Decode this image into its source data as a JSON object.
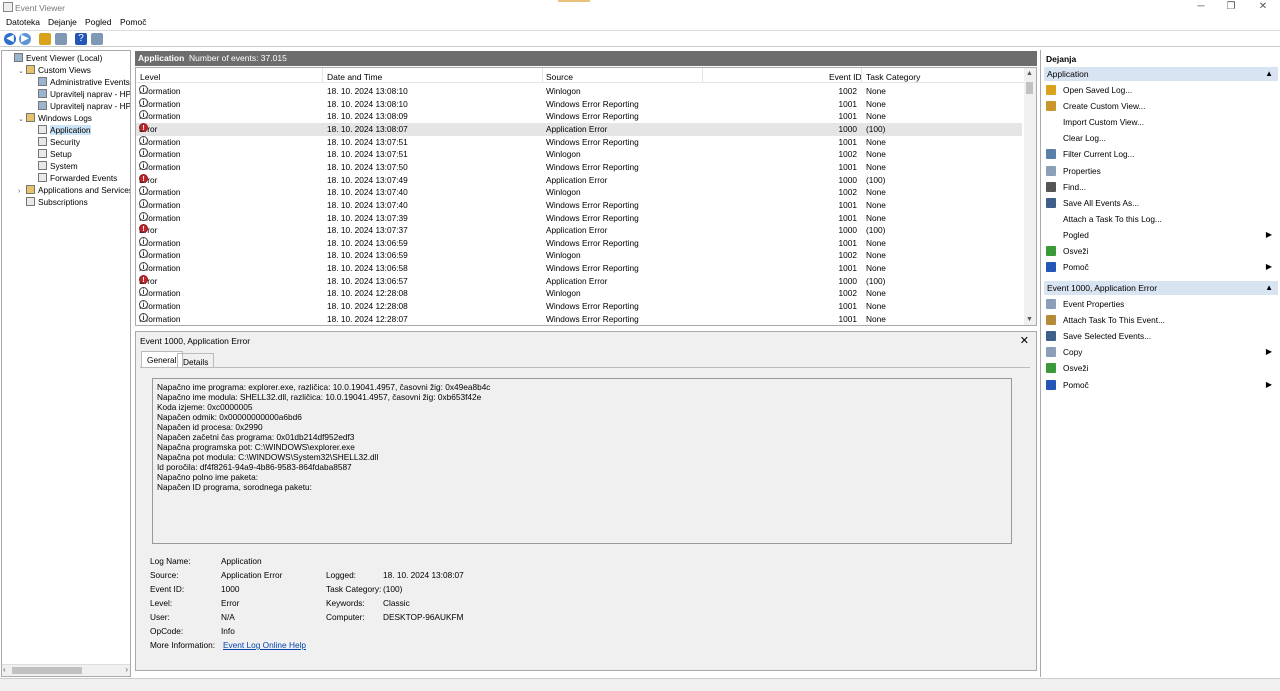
{
  "window": {
    "title": "Event Viewer",
    "controls": [
      "─",
      "❐",
      "✕"
    ]
  },
  "menu": [
    "Datoteka",
    "Dejanje",
    "Pogled",
    "Pomoč"
  ],
  "tree": [
    {
      "label": "Event Viewer (Local)",
      "indent": 0,
      "expander": "",
      "icon": "computer-icon"
    },
    {
      "label": "Custom Views",
      "indent": 1,
      "expander": "v",
      "icon": "folder-icon"
    },
    {
      "label": "Administrative Events",
      "indent": 2,
      "expander": "",
      "icon": "filter-icon"
    },
    {
      "label": "Upravitelj naprav - HP De",
      "indent": 2,
      "expander": "",
      "icon": "filter-icon"
    },
    {
      "label": "Upravitelj naprav - HP De",
      "indent": 2,
      "expander": "",
      "icon": "filter-icon"
    },
    {
      "label": "Windows Logs",
      "indent": 1,
      "expander": "v",
      "icon": "folder-icon"
    },
    {
      "label": "Application",
      "indent": 2,
      "expander": "",
      "icon": "log-icon",
      "selected": true
    },
    {
      "label": "Security",
      "indent": 2,
      "expander": "",
      "icon": "log-icon"
    },
    {
      "label": "Setup",
      "indent": 2,
      "expander": "",
      "icon": "log-icon"
    },
    {
      "label": "System",
      "indent": 2,
      "expander": "",
      "icon": "log-icon"
    },
    {
      "label": "Forwarded Events",
      "indent": 2,
      "expander": "",
      "icon": "log-icon"
    },
    {
      "label": "Applications and Services Lo",
      "indent": 1,
      "expander": ">",
      "icon": "folder-icon"
    },
    {
      "label": "Subscriptions",
      "indent": 1,
      "expander": "",
      "icon": "subscriptions-icon"
    }
  ],
  "center": {
    "log_name": "Application",
    "count_text": "Number of events: 37.015"
  },
  "columns": [
    "Level",
    "Date and Time",
    "Source",
    "Event ID",
    "Task Category"
  ],
  "events": [
    {
      "level": "Information",
      "date": "18. 10. 2024 13:08:10",
      "source": "Winlogon",
      "id": "1002",
      "cat": "None"
    },
    {
      "level": "Information",
      "date": "18. 10. 2024 13:08:10",
      "source": "Windows Error Reporting",
      "id": "1001",
      "cat": "None"
    },
    {
      "level": "Information",
      "date": "18. 10. 2024 13:08:09",
      "source": "Windows Error Reporting",
      "id": "1001",
      "cat": "None"
    },
    {
      "level": "Error",
      "date": "18. 10. 2024 13:08:07",
      "source": "Application Error",
      "id": "1000",
      "cat": "(100)",
      "selected": true
    },
    {
      "level": "Information",
      "date": "18. 10. 2024 13:07:51",
      "source": "Windows Error Reporting",
      "id": "1001",
      "cat": "None"
    },
    {
      "level": "Information",
      "date": "18. 10. 2024 13:07:51",
      "source": "Winlogon",
      "id": "1002",
      "cat": "None"
    },
    {
      "level": "Information",
      "date": "18. 10. 2024 13:07:50",
      "source": "Windows Error Reporting",
      "id": "1001",
      "cat": "None"
    },
    {
      "level": "Error",
      "date": "18. 10. 2024 13:07:49",
      "source": "Application Error",
      "id": "1000",
      "cat": "(100)"
    },
    {
      "level": "Information",
      "date": "18. 10. 2024 13:07:40",
      "source": "Winlogon",
      "id": "1002",
      "cat": "None"
    },
    {
      "level": "Information",
      "date": "18. 10. 2024 13:07:40",
      "source": "Windows Error Reporting",
      "id": "1001",
      "cat": "None"
    },
    {
      "level": "Information",
      "date": "18. 10. 2024 13:07:39",
      "source": "Windows Error Reporting",
      "id": "1001",
      "cat": "None"
    },
    {
      "level": "Error",
      "date": "18. 10. 2024 13:07:37",
      "source": "Application Error",
      "id": "1000",
      "cat": "(100)"
    },
    {
      "level": "Information",
      "date": "18. 10. 2024 13:06:59",
      "source": "Windows Error Reporting",
      "id": "1001",
      "cat": "None"
    },
    {
      "level": "Information",
      "date": "18. 10. 2024 13:06:59",
      "source": "Winlogon",
      "id": "1002",
      "cat": "None"
    },
    {
      "level": "Information",
      "date": "18. 10. 2024 13:06:58",
      "source": "Windows Error Reporting",
      "id": "1001",
      "cat": "None"
    },
    {
      "level": "Error",
      "date": "18. 10. 2024 13:06:57",
      "source": "Application Error",
      "id": "1000",
      "cat": "(100)"
    },
    {
      "level": "Information",
      "date": "18. 10. 2024 12:28:08",
      "source": "Winlogon",
      "id": "1002",
      "cat": "None"
    },
    {
      "level": "Information",
      "date": "18. 10. 2024 12:28:08",
      "source": "Windows Error Reporting",
      "id": "1001",
      "cat": "None"
    },
    {
      "level": "Information",
      "date": "18. 10. 2024 12:28:07",
      "source": "Windows Error Reporting",
      "id": "1001",
      "cat": "None"
    }
  ],
  "detail": {
    "title": "Event 1000, Application Error",
    "close": "✕",
    "tabs": [
      "General",
      "Details"
    ],
    "description": [
      "Napačno ime programa: explorer.exe, različica: 10.0.19041.4957, časovni žig: 0x49ea8b4c",
      "Napačno ime modula: SHELL32.dll, različica: 10.0.19041.4957, časovni žig: 0xb653f42e",
      "Koda izjeme: 0xc0000005",
      "Napačen odmik: 0x00000000000a6bd6",
      "Napačen id procesa: 0x2990",
      "Napačen začetni čas programa: 0x01db214df952edf3",
      "Napačna programska pot: C:\\WINDOWS\\explorer.exe",
      "Napačna pot modula: C:\\WINDOWS\\System32\\SHELL32.dll",
      "Id poročila: df4f8261-94a9-4b86-9583-864fdaba8587",
      "Napačno polno ime paketa:",
      "Napačen ID programa, sorodnega paketu:"
    ],
    "fields": {
      "log_name_label": "Log Name:",
      "log_name": "Application",
      "source_label": "Source:",
      "source": "Application Error",
      "logged_label": "Logged:",
      "logged": "18. 10. 2024 13:08:07",
      "event_id_label": "Event ID:",
      "event_id": "1000",
      "task_label": "Task Category:",
      "task": "(100)",
      "level_label": "Level:",
      "level": "Error",
      "keywords_label": "Keywords:",
      "keywords": "Classic",
      "user_label": "User:",
      "user": "N/A",
      "computer_label": "Computer:",
      "computer": "DESKTOP-96AUKFM",
      "opcode_label": "OpCode:",
      "opcode": "Info",
      "more_label": "More Information:",
      "more_link": "Event Log Online Help"
    }
  },
  "actions": {
    "header": "Dejanja",
    "section1": {
      "title": "Application",
      "items": [
        {
          "label": "Open Saved Log...",
          "icon": "open-log-icon",
          "color": "#d9a21b"
        },
        {
          "label": "Create Custom View...",
          "icon": "create-view-icon",
          "color": "#c9962b"
        },
        {
          "label": "Import Custom View...",
          "icon": "",
          "color": ""
        },
        {
          "label": "Clear Log...",
          "icon": "",
          "color": ""
        },
        {
          "label": "Filter Current Log...",
          "icon": "filter-icon",
          "color": "#5a7fa8"
        },
        {
          "label": "Properties",
          "icon": "properties-icon",
          "color": "#8aa0b8"
        },
        {
          "label": "Find...",
          "icon": "find-icon",
          "color": "#555555"
        },
        {
          "label": "Save All Events As...",
          "icon": "save-icon",
          "color": "#3f5f8a"
        },
        {
          "label": "Attach a Task To this Log...",
          "icon": "",
          "color": ""
        },
        {
          "label": "Pogled",
          "icon": "",
          "color": "",
          "submenu": true
        },
        {
          "label": "Osveži",
          "icon": "refresh-icon",
          "color": "#3a9a3a"
        },
        {
          "label": "Pomoč",
          "icon": "help-icon",
          "color": "#2456b8",
          "submenu": true
        }
      ]
    },
    "section2": {
      "title": "Event 1000, Application Error",
      "items": [
        {
          "label": "Event Properties",
          "icon": "event-properties-icon",
          "color": "#8aa0b8"
        },
        {
          "label": "Attach Task To This Event...",
          "icon": "attach-task-icon",
          "color": "#b58a3a"
        },
        {
          "label": "Save Selected Events...",
          "icon": "save-icon",
          "color": "#3f5f8a"
        },
        {
          "label": "Copy",
          "icon": "copy-icon",
          "color": "#8aa0b8",
          "submenu": true
        },
        {
          "label": "Osveži",
          "icon": "refresh-icon",
          "color": "#3a9a3a"
        },
        {
          "label": "Pomoč",
          "icon": "help-icon",
          "color": "#2456b8",
          "submenu": true
        }
      ]
    }
  },
  "colors": {
    "header_bg": "#6d6d6d",
    "selection": "#cce4f7",
    "section_bg": "#d8e4f2",
    "error_red": "#c0272d",
    "link": "#0645ad"
  }
}
